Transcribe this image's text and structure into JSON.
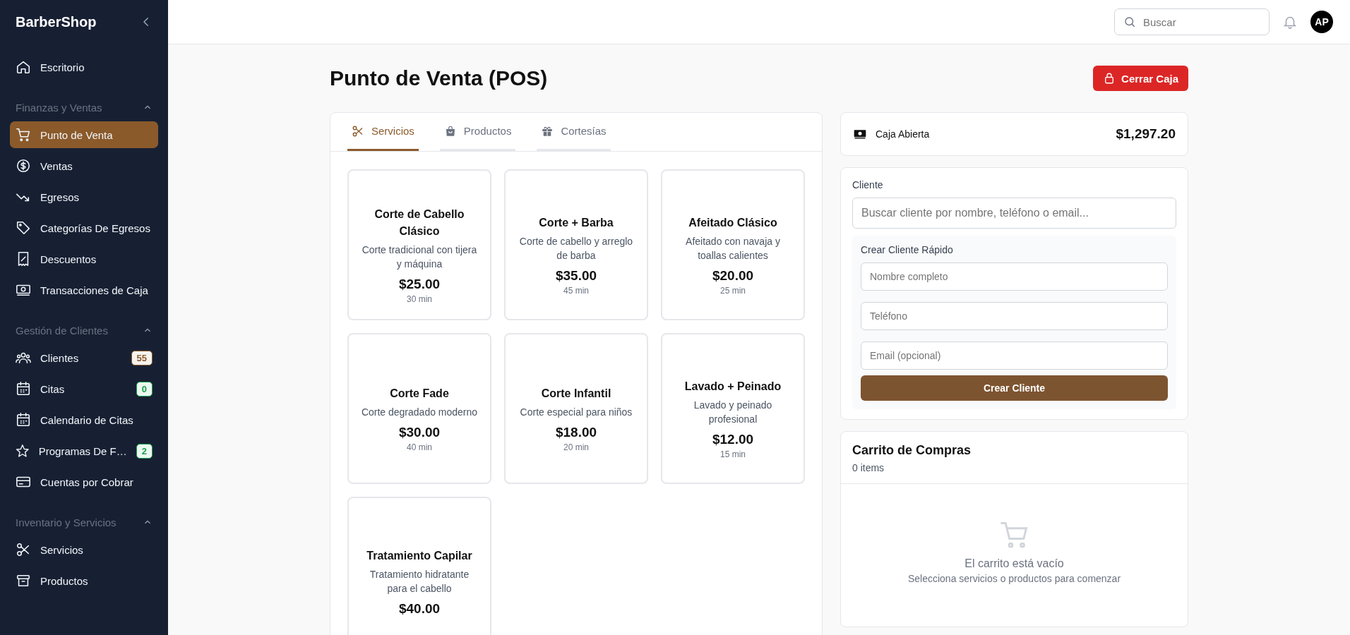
{
  "sidebar": {
    "brand": "BarberShop",
    "top_items": [
      {
        "label": "Escritorio",
        "selected": false
      }
    ],
    "sections": [
      {
        "title": "Finanzas y Ventas",
        "expanded": true,
        "items": [
          {
            "label": "Punto de Venta",
            "selected": true
          },
          {
            "label": "Ventas",
            "selected": false
          },
          {
            "label": "Egresos",
            "selected": false
          },
          {
            "label": "Categorías De Egresos",
            "selected": false
          },
          {
            "label": "Descuentos",
            "selected": false
          },
          {
            "label": "Transacciones de Caja",
            "selected": false
          }
        ]
      },
      {
        "title": "Gestión de Clientes",
        "expanded": true,
        "items": [
          {
            "label": "Clientes",
            "selected": false,
            "badge": "55",
            "color": "#8b5a2b"
          },
          {
            "label": "Citas",
            "selected": false,
            "badge": "0",
            "color": "#16a34a"
          },
          {
            "label": "Calendario de Citas",
            "selected": false
          },
          {
            "label": "Programas De F…",
            "selected": false,
            "badge": "2",
            "color": "#16a34a"
          },
          {
            "label": "Cuentas por Cobrar",
            "selected": false
          }
        ]
      },
      {
        "title": "Inventario y Servicios",
        "expanded": true,
        "items": [
          {
            "label": "Servicios",
            "selected": false
          },
          {
            "label": "Productos",
            "selected": false
          }
        ]
      }
    ]
  },
  "header": {
    "search": {
      "placeholder": "Buscar"
    },
    "avatar": "AP"
  },
  "page": {
    "title": "Punto de Venta (POS)",
    "close_button": "Cerrar Caja"
  },
  "tabs": [
    {
      "label": "Servicios",
      "selected": true
    },
    {
      "label": "Productos",
      "selected": false
    },
    {
      "label": "Cortesías",
      "selected": false
    }
  ],
  "services": [
    {
      "name": "Corte de Cabello Clásico",
      "description": "Corte tradicional con tijera y máquina",
      "price": "$25.00",
      "duration": "30 min"
    },
    {
      "name": "Corte + Barba",
      "description": "Corte de cabello y arreglo de barba",
      "price": "$35.00",
      "duration": "45 min"
    },
    {
      "name": "Afeitado Clásico",
      "description": "Afeitado con navaja y toallas calientes",
      "price": "$20.00",
      "duration": "25 min"
    },
    {
      "name": "Corte Fade",
      "description": "Corte degradado moderno",
      "price": "$30.00",
      "duration": "40 min"
    },
    {
      "name": "Corte Infantil",
      "description": "Corte especial para niños",
      "price": "$18.00",
      "duration": "20 min"
    },
    {
      "name": "Lavado + Peinado",
      "description": "Lavado y peinado profesional",
      "price": "$12.00",
      "duration": "15 min"
    },
    {
      "name": "Tratamiento Capilar",
      "description": "Tratamiento hidratante para el cabello",
      "price": "$40.00"
    }
  ],
  "cash": {
    "label": "Caja Abierta",
    "amount": "$1,297.20"
  },
  "client": {
    "label": "Cliente",
    "search_placeholder": "Buscar cliente por nombre, teléfono o email...",
    "quick_title": "Crear Cliente Rápido",
    "fields": [
      {
        "placeholder": "Nombre completo"
      },
      {
        "placeholder": "Teléfono"
      },
      {
        "placeholder": "Email (opcional)"
      }
    ],
    "create_button": "Crear Cliente"
  },
  "cart": {
    "title": "Carrito de Compras",
    "count": "0 items",
    "empty_title": "El carrito está vacío",
    "empty_hint": "Selecciona servicios o productos para comenzar"
  }
}
